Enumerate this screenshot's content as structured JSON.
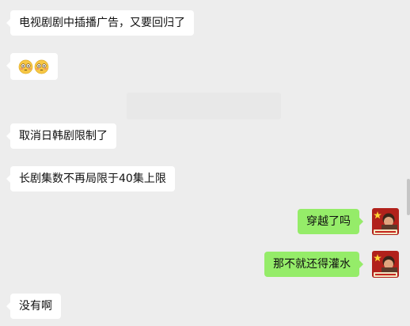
{
  "messages": [
    {
      "side": "in",
      "text": "电视剧剧中插播广告，又要回归了"
    },
    {
      "side": "in",
      "emoji": [
        "flushed-face",
        "flushed-face"
      ]
    },
    {
      "side": "in",
      "text": "取消日韩剧限制了"
    },
    {
      "side": "in",
      "text": "长剧集数不再局限于40集上限"
    },
    {
      "side": "out",
      "text": "穿越了吗"
    },
    {
      "side": "out",
      "text": "那不就还得灌水"
    },
    {
      "side": "in",
      "text": "没有啊"
    }
  ],
  "colors": {
    "background": "#ededed",
    "incoming_bubble": "#ffffff",
    "outgoing_bubble": "#95ec69",
    "text": "#111111"
  },
  "avatar": {
    "icon": "red-flag-avatar-icon"
  }
}
